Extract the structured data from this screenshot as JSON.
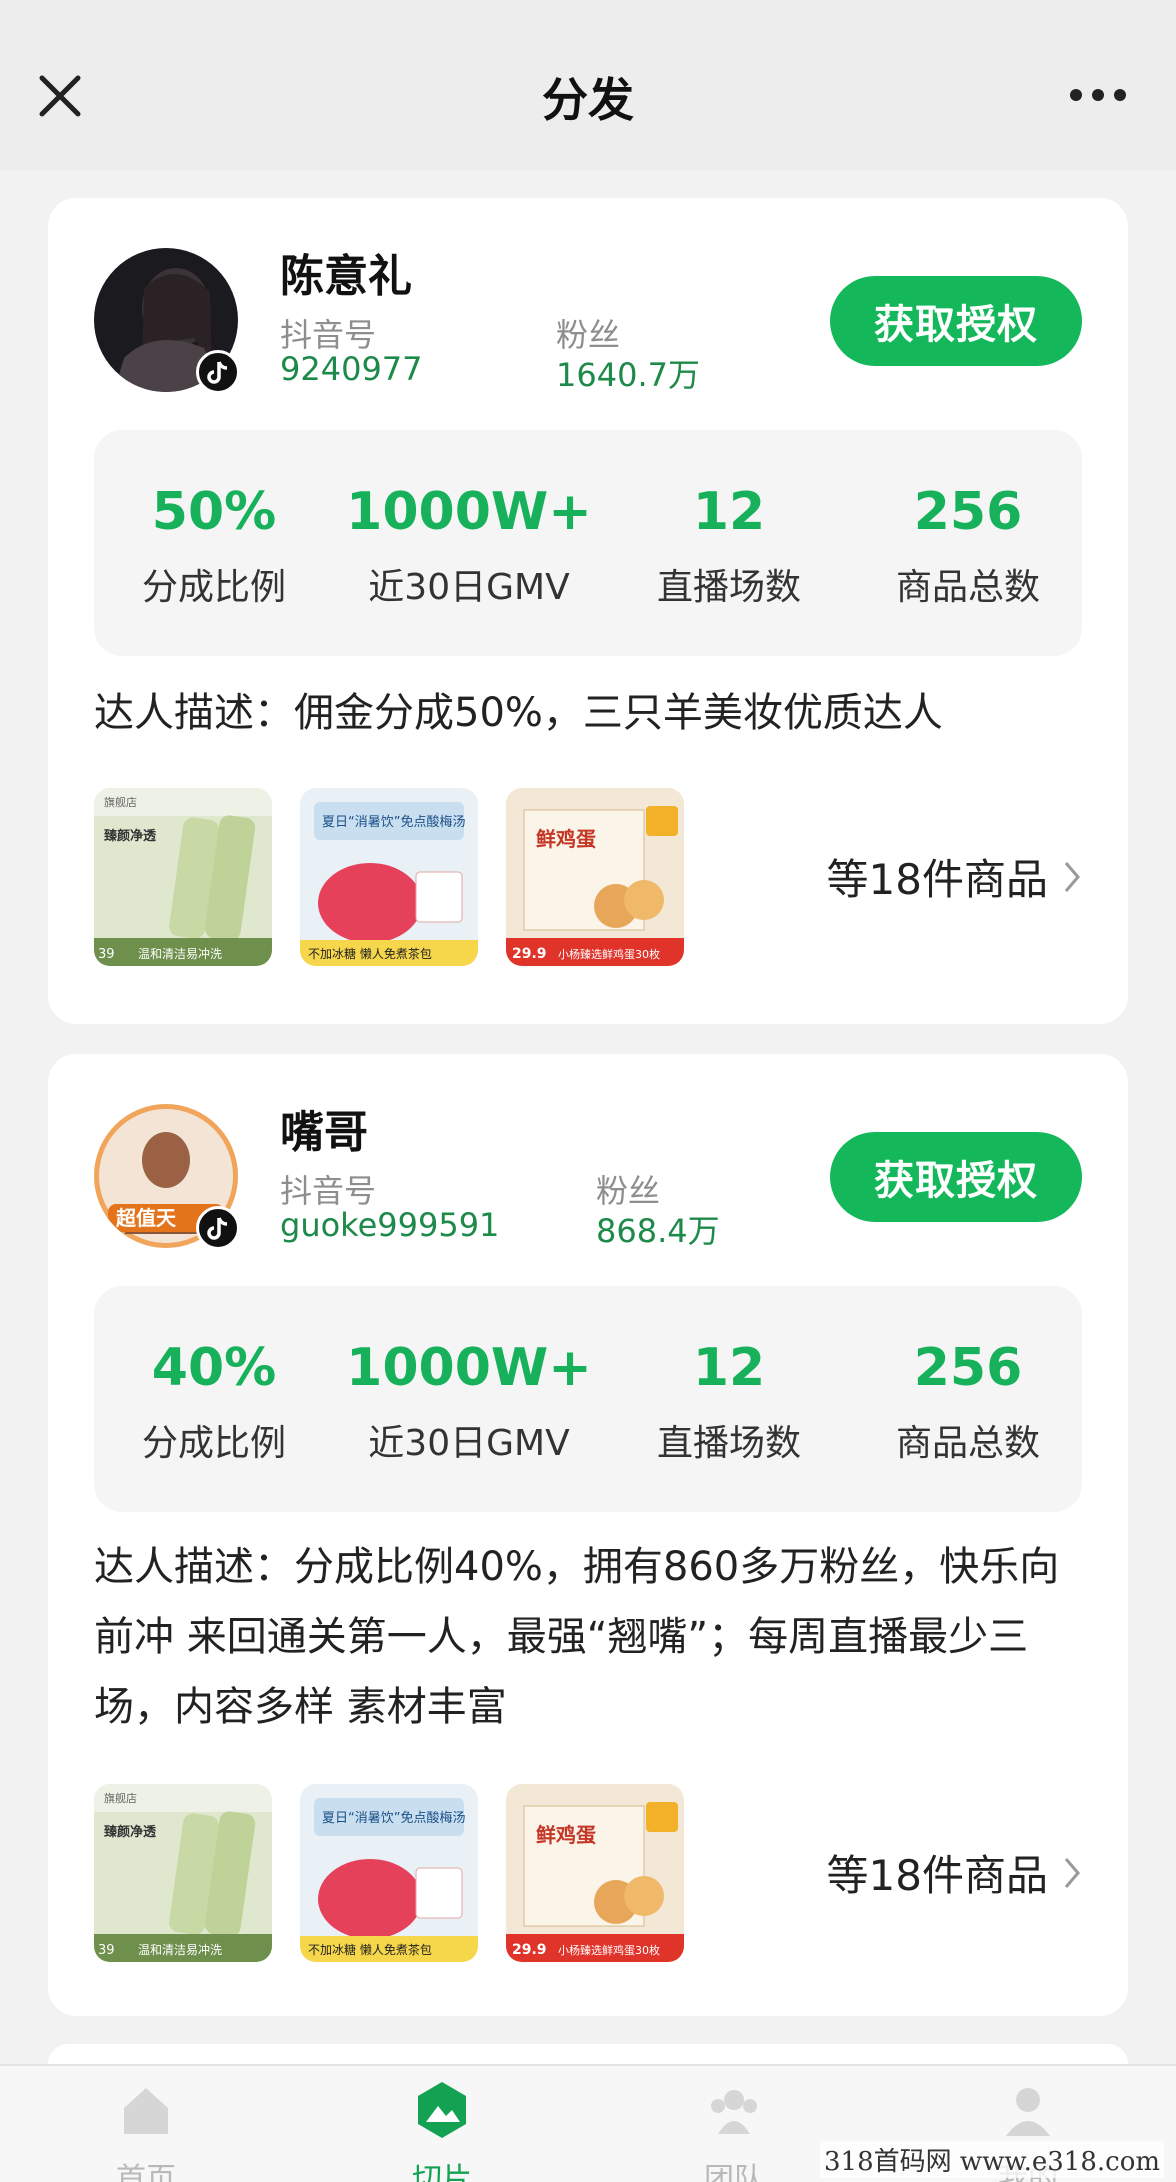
{
  "header": {
    "title": "分发",
    "close_icon": "close-icon",
    "more_icon": "more-horizontal-icon"
  },
  "influencers": [
    {
      "name": "陈意礼",
      "douyin_label": "抖音号",
      "douyin_id": "9240977",
      "fans_label": "粉丝",
      "fans": "1640.7万",
      "auth_button": "获取授权",
      "stats": [
        {
          "value": "50%",
          "label": "分成比例"
        },
        {
          "value": "1000W+",
          "label": "近30日GMV"
        },
        {
          "value": "12",
          "label": "直播场数"
        },
        {
          "value": "256",
          "label": "商品总数"
        }
      ],
      "description": "达人描述：佣金分成50%，三只羊美妆优质达人",
      "products": [
        {
          "caption": "温和清洁易冲洗",
          "price": "39",
          "title": "臻颜净透"
        },
        {
          "caption": "不加冰糖 懒人免煮茶包",
          "title": "夏日“消暑饮”免点酸梅汤"
        },
        {
          "caption": "小杨臻选鲜鸡蛋30枚",
          "price": "29.9",
          "title": "鲜鸡蛋"
        }
      ],
      "more_goods": "等18件商品"
    },
    {
      "name": "嘴哥",
      "douyin_label": "抖音号",
      "douyin_id": "guoke999591",
      "fans_label": "粉丝",
      "fans": "868.4万",
      "auth_button": "获取授权",
      "stats": [
        {
          "value": "40%",
          "label": "分成比例"
        },
        {
          "value": "1000W+",
          "label": "近30日GMV"
        },
        {
          "value": "12",
          "label": "直播场数"
        },
        {
          "value": "256",
          "label": "商品总数"
        }
      ],
      "description": "达人描述：分成比例40%，拥有860多万粉丝，快乐向前冲 来回通关第一人，最强“翘嘴”；每周直播最少三场，内容多样 素材丰富",
      "products": [
        {
          "caption": "温和清洁易冲洗",
          "price": "39",
          "title": "臻颜净透"
        },
        {
          "caption": "不加冰糖 懒人免煮茶包",
          "title": "夏日“消暑饮”免点酸梅汤"
        },
        {
          "caption": "小杨臻选鲜鸡蛋30枚",
          "price": "29.9",
          "title": "鲜鸡蛋"
        }
      ],
      "more_goods": "等18件商品"
    }
  ],
  "tabbar": [
    {
      "label": "首页",
      "icon": "home-icon",
      "active": false
    },
    {
      "label": "切片",
      "icon": "mountain-icon",
      "active": true
    },
    {
      "label": "团队",
      "icon": "team-icon",
      "active": false
    },
    {
      "label": "我的",
      "icon": "user-icon",
      "active": false
    }
  ],
  "watermark": "318首码网 www.e318.com",
  "colors": {
    "accent": "#14b85b",
    "stat_green": "#16b15a",
    "id_green": "#1d8a4a"
  }
}
